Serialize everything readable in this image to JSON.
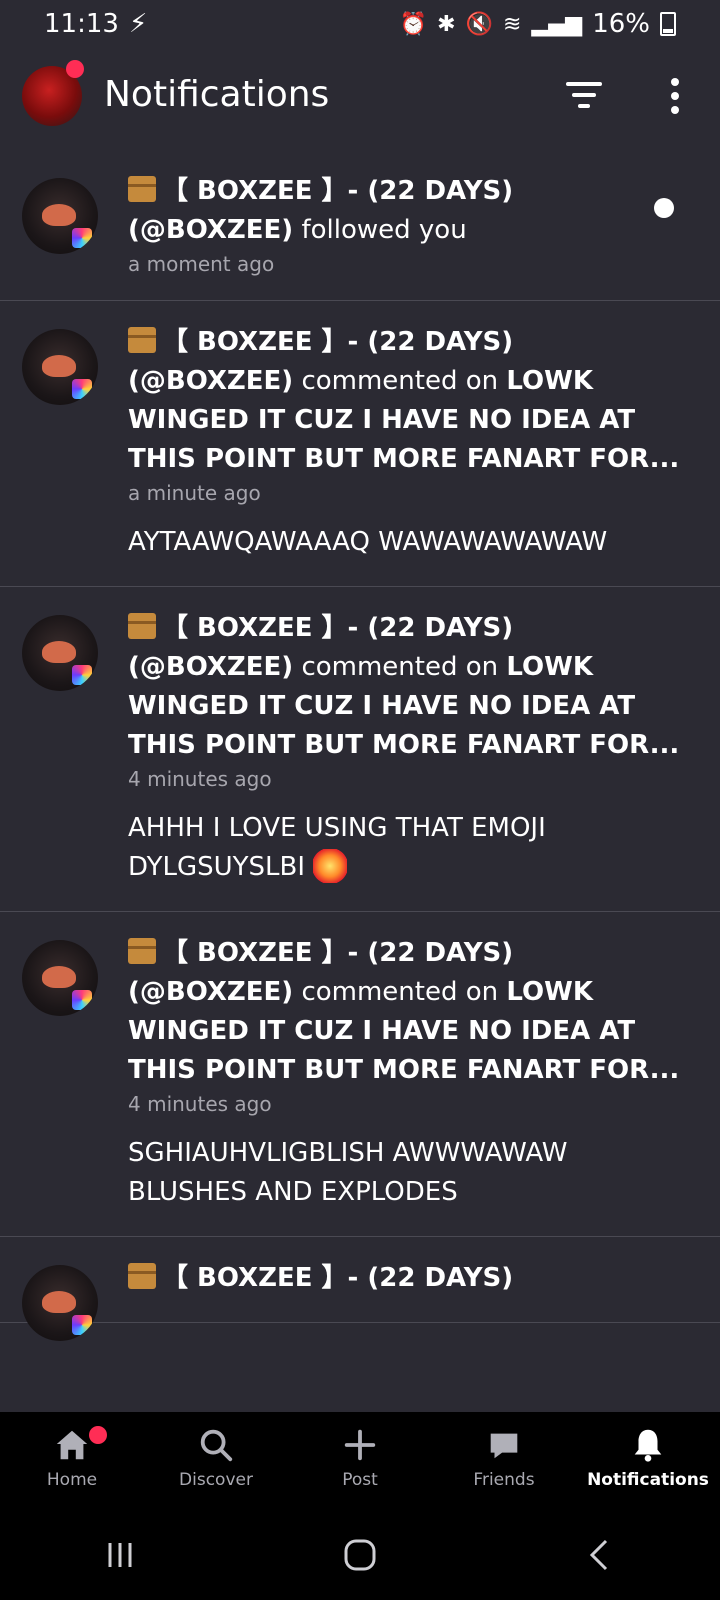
{
  "status_bar": {
    "time": "11:13",
    "battery_percent": "16%"
  },
  "header": {
    "title": "Notifications"
  },
  "notifications": [
    {
      "name": "【 BOXZEE 】- (22 DAYS)",
      "handle": "(@BOXZEE)",
      "action": "followed you",
      "post_title": "",
      "time": "a moment ago",
      "comment": "",
      "unread": true
    },
    {
      "name": "【 BOXZEE 】- (22 DAYS)",
      "handle": "(@BOXZEE)",
      "action": "commented on",
      "post_title": "LOWK WINGED IT CUZ I HAVE NO IDEA AT THIS POINT BUT MORE FANART FOR...",
      "time": "a minute ago",
      "comment": "AYTAAWQAWAAAQ WAWAWAWAWAW",
      "unread": false
    },
    {
      "name": "【 BOXZEE 】- (22 DAYS)",
      "handle": "(@BOXZEE)",
      "action": "commented on",
      "post_title": "LOWK WINGED IT CUZ I HAVE NO IDEA AT THIS POINT BUT MORE FANART FOR...",
      "time": "4 minutes ago",
      "comment": "AHHH I LOVE USING THAT EMOJI DYLGSUYSLBI",
      "unread": false
    },
    {
      "name": "【 BOXZEE 】- (22 DAYS)",
      "handle": "(@BOXZEE)",
      "action": "commented on",
      "post_title": "LOWK WINGED IT CUZ I HAVE NO IDEA AT THIS POINT BUT MORE FANART FOR...",
      "time": "4 minutes ago",
      "comment": "SGHIAUHVLIGBLISH AWWWAWAW BLUSHES AND EXPLODES",
      "unread": false
    },
    {
      "name": "【 BOXZEE 】- (22 DAYS)",
      "handle": "",
      "action": "",
      "post_title": "",
      "time": "",
      "comment": "",
      "unread": false
    }
  ],
  "bottom_nav": {
    "home": "Home",
    "discover": "Discover",
    "post": "Post",
    "friends": "Friends",
    "notifications": "Notifications"
  },
  "colors": {
    "background": "#2b2a33",
    "accent_dot": "#ff2d55",
    "nav_bg": "#000000"
  }
}
